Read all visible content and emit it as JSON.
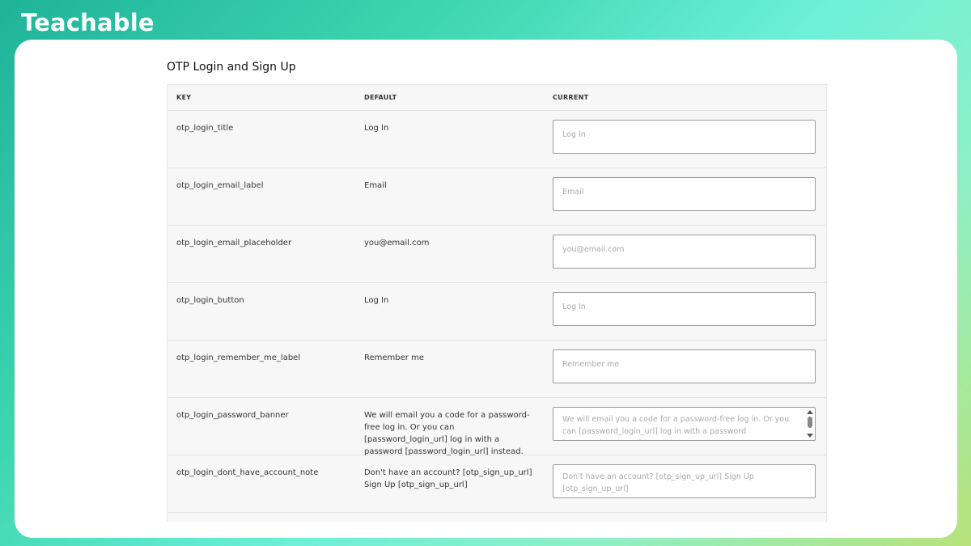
{
  "brand": "Teachable",
  "section_title": "OTP Login and Sign Up",
  "columns": {
    "key": "KEY",
    "default": "DEFAULT",
    "current": "CURRENT"
  },
  "rows": [
    {
      "key": "otp_login_title",
      "default": "Log In",
      "placeholder": "Log In"
    },
    {
      "key": "otp_login_email_label",
      "default": "Email",
      "placeholder": "Email"
    },
    {
      "key": "otp_login_email_placeholder",
      "default": "you@email.com",
      "placeholder": "you@email.com"
    },
    {
      "key": "otp_login_button",
      "default": "Log In",
      "placeholder": "Log In"
    },
    {
      "key": "otp_login_remember_me_label",
      "default": "Remember me",
      "placeholder": "Remember me"
    },
    {
      "key": "otp_login_password_banner",
      "default": "We will email you a code for a password-free log in. Or you can [password_login_url] log in with a password [password_login_url] instead.",
      "placeholder": "We will email you a code for a password-free log in. Or you can [password_login_url] log in with a password [password_login_url] instead."
    },
    {
      "key": "otp_login_dont_have_account_note",
      "default": "Don't have an account? [otp_sign_up_url] Sign Up [otp_sign_up_url]",
      "placeholder": "Don't have an account? [otp_sign_up_url] Sign Up [otp_sign_up_url]"
    },
    {
      "key": "",
      "default": "",
      "placeholder": ""
    }
  ]
}
